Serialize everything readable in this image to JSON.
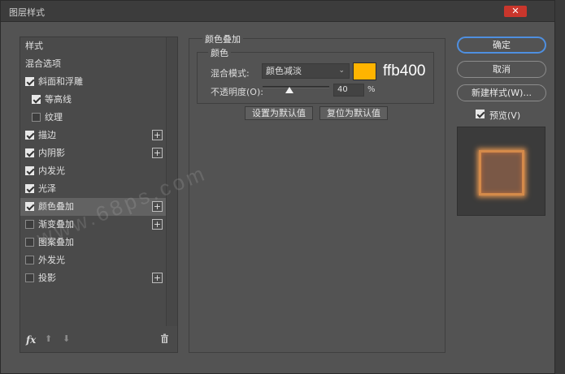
{
  "window": {
    "title": "图层样式",
    "close_label": "✕"
  },
  "left": {
    "items": [
      {
        "label": "样式",
        "has_checkbox": false,
        "checked": false,
        "has_plus": false,
        "indent": 0,
        "selected": false
      },
      {
        "label": "混合选项",
        "has_checkbox": false,
        "checked": false,
        "has_plus": false,
        "indent": 0,
        "selected": false
      },
      {
        "label": "斜面和浮雕",
        "has_checkbox": true,
        "checked": true,
        "has_plus": false,
        "indent": 0,
        "selected": false
      },
      {
        "label": "等高线",
        "has_checkbox": true,
        "checked": true,
        "has_plus": false,
        "indent": 1,
        "selected": false
      },
      {
        "label": "纹理",
        "has_checkbox": true,
        "checked": false,
        "has_plus": false,
        "indent": 1,
        "selected": false
      },
      {
        "label": "描边",
        "has_checkbox": true,
        "checked": true,
        "has_plus": true,
        "indent": 0,
        "selected": false
      },
      {
        "label": "内阴影",
        "has_checkbox": true,
        "checked": true,
        "has_plus": true,
        "indent": 0,
        "selected": false
      },
      {
        "label": "内发光",
        "has_checkbox": true,
        "checked": true,
        "has_plus": false,
        "indent": 0,
        "selected": false
      },
      {
        "label": "光泽",
        "has_checkbox": true,
        "checked": true,
        "has_plus": false,
        "indent": 0,
        "selected": false
      },
      {
        "label": "颜色叠加",
        "has_checkbox": true,
        "checked": true,
        "has_plus": true,
        "indent": 0,
        "selected": true
      },
      {
        "label": "渐变叠加",
        "has_checkbox": true,
        "checked": false,
        "has_plus": true,
        "indent": 0,
        "selected": false
      },
      {
        "label": "图案叠加",
        "has_checkbox": true,
        "checked": false,
        "has_plus": false,
        "indent": 0,
        "selected": false
      },
      {
        "label": "外发光",
        "has_checkbox": true,
        "checked": false,
        "has_plus": false,
        "indent": 0,
        "selected": false
      },
      {
        "label": "投影",
        "has_checkbox": true,
        "checked": false,
        "has_plus": true,
        "indent": 0,
        "selected": false
      }
    ],
    "footer": {
      "fx": "fx",
      "up": "⬆",
      "down": "⬇",
      "trash": "🗑"
    }
  },
  "color_overlay": {
    "group_title": "颜色叠加",
    "sub_title": "颜色",
    "blend_label": "混合模式:",
    "blend_value": "颜色减淡",
    "color_hex_label": "ffb400",
    "swatch_color": "#ffb400",
    "opacity_label": "不透明度(O):",
    "opacity_value": "40",
    "opacity_unit": "%",
    "opacity_level": 0.4,
    "set_default_label": "设置为默认值",
    "reset_default_label": "复位为默认值"
  },
  "actions": {
    "ok_label": "确定",
    "cancel_label": "取消",
    "new_style_label": "新建样式(W)...",
    "preview_label": "预览(V)",
    "preview_checked": true
  },
  "watermark": "www.68ps.com"
}
